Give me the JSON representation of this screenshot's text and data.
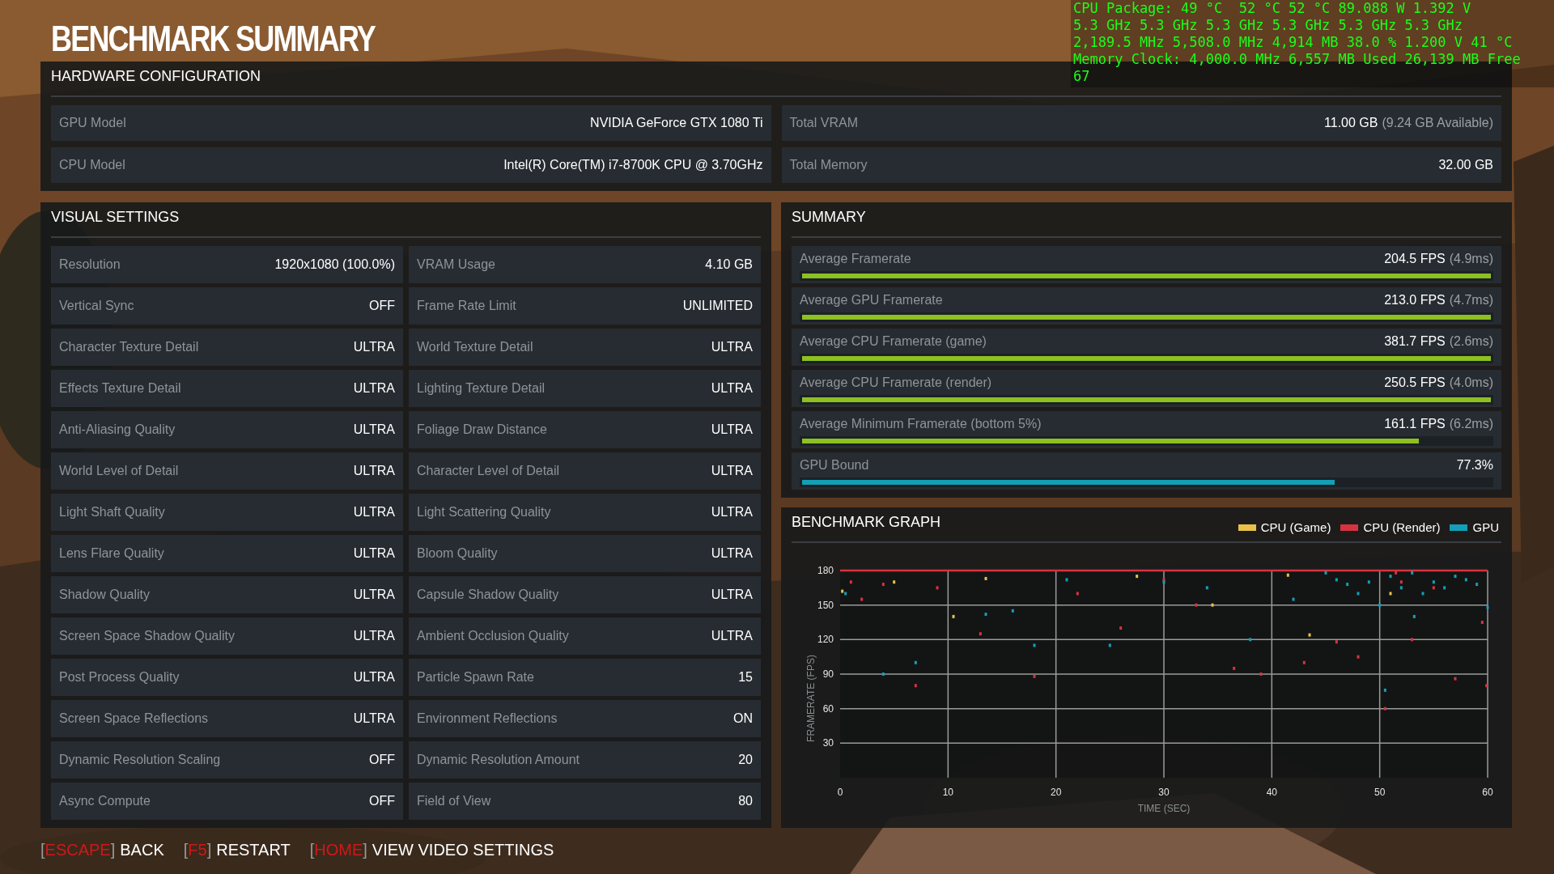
{
  "title": "BENCHMARK SUMMARY",
  "overlay": [
    "CPU Package: 49 °C  52 °C 52 °C 89.088 W 1.392 V",
    "5.3 GHz 5.3 GHz 5.3 GHz 5.3 GHz 5.3 GHz 5.3 GHz",
    "2,189.5 MHz 5,508.0 MHz 4,914 MB 38.0 % 1.200 V 41 °C",
    "Memory Clock: 4,000.0 MHz 6,557 MB Used 26,139 MB Free",
    "67"
  ],
  "hardware": {
    "heading": "HARDWARE CONFIGURATION",
    "items": [
      {
        "label": "GPU Model",
        "value": "NVIDIA GeForce GTX 1080 Ti"
      },
      {
        "label": "Total VRAM",
        "value": "11.00 GB",
        "detail": "(9.24 GB Available)"
      },
      {
        "label": "CPU Model",
        "value": "Intel(R) Core(TM) i7-8700K CPU @ 3.70GHz"
      },
      {
        "label": "Total Memory",
        "value": "32.00 GB"
      }
    ]
  },
  "visual_settings": {
    "heading": "VISUAL SETTINGS",
    "items": [
      {
        "label": "Resolution",
        "value": "1920x1080 (100.0%)"
      },
      {
        "label": "VRAM Usage",
        "value": "4.10 GB"
      },
      {
        "label": "Vertical Sync",
        "value": "OFF"
      },
      {
        "label": "Frame Rate Limit",
        "value": "UNLIMITED"
      },
      {
        "label": "Character Texture Detail",
        "value": "ULTRA"
      },
      {
        "label": "World Texture Detail",
        "value": "ULTRA"
      },
      {
        "label": "Effects Texture Detail",
        "value": "ULTRA"
      },
      {
        "label": "Lighting Texture Detail",
        "value": "ULTRA"
      },
      {
        "label": "Anti-Aliasing Quality",
        "value": "ULTRA"
      },
      {
        "label": "Foliage Draw Distance",
        "value": "ULTRA"
      },
      {
        "label": "World Level of Detail",
        "value": "ULTRA"
      },
      {
        "label": "Character Level of Detail",
        "value": "ULTRA"
      },
      {
        "label": "Light Shaft Quality",
        "value": "ULTRA"
      },
      {
        "label": "Light Scattering Quality",
        "value": "ULTRA"
      },
      {
        "label": "Lens Flare Quality",
        "value": "ULTRA"
      },
      {
        "label": "Bloom Quality",
        "value": "ULTRA"
      },
      {
        "label": "Shadow Quality",
        "value": "ULTRA"
      },
      {
        "label": "Capsule Shadow Quality",
        "value": "ULTRA"
      },
      {
        "label": "Screen Space Shadow Quality",
        "value": "ULTRA"
      },
      {
        "label": "Ambient Occlusion Quality",
        "value": "ULTRA"
      },
      {
        "label": "Post Process Quality",
        "value": "ULTRA"
      },
      {
        "label": "Particle Spawn Rate",
        "value": "15"
      },
      {
        "label": "Screen Space Reflections",
        "value": "ULTRA"
      },
      {
        "label": "Environment Reflections",
        "value": "ON"
      },
      {
        "label": "Dynamic Resolution Scaling",
        "value": "OFF"
      },
      {
        "label": "Dynamic Resolution Amount",
        "value": "20"
      },
      {
        "label": "Async Compute",
        "value": "OFF"
      },
      {
        "label": "Field of View",
        "value": "80"
      }
    ]
  },
  "summary": {
    "heading": "SUMMARY",
    "items": [
      {
        "label": "Average Framerate",
        "value": "204.5 FPS",
        "detail": "(4.9ms)",
        "level": 1.0,
        "color": "#8dc021"
      },
      {
        "label": "Average GPU Framerate",
        "value": "213.0 FPS",
        "detail": "(4.7ms)",
        "level": 1.0,
        "color": "#8dc021"
      },
      {
        "label": "Average CPU Framerate (game)",
        "value": "381.7 FPS",
        "detail": "(2.6ms)",
        "level": 1.0,
        "color": "#8dc021"
      },
      {
        "label": "Average CPU Framerate (render)",
        "value": "250.5 FPS",
        "detail": "(4.0ms)",
        "level": 1.0,
        "color": "#8dc021"
      },
      {
        "label": "Average Minimum Framerate (bottom 5%)",
        "value": "161.1 FPS",
        "detail": "(6.2ms)",
        "level": 0.895,
        "color": "#8dc021"
      },
      {
        "label": "GPU Bound",
        "value": "77.3%",
        "level": 0.773,
        "color": "#139fb6"
      }
    ]
  },
  "graph": {
    "heading": "BENCHMARK GRAPH",
    "chart_data": {
      "type": "scatter",
      "xlabel": "TIME (SEC)",
      "ylabel": "FRAMERATE (FPS)",
      "xlim": [
        0,
        60
      ],
      "ylim": [
        0,
        180
      ],
      "xticks": [
        0,
        10,
        20,
        30,
        40,
        50,
        60
      ],
      "yticks": [
        30,
        60,
        90,
        120,
        150,
        180
      ],
      "grid": true,
      "series": [
        {
          "name": "CPU (Game)",
          "color": "#e8c14a",
          "x": [
            0.2,
            5,
            10.5,
            13.5,
            27.5,
            34.5,
            41.5,
            43.5,
            51
          ],
          "values": [
            162,
            170,
            140,
            173,
            175,
            150,
            176,
            124,
            160
          ]
        },
        {
          "name": "CPU (Render)",
          "color": "#d63340",
          "x": [
            1,
            2,
            4,
            7,
            9,
            13,
            18,
            22,
            26,
            30,
            33,
            36.5,
            39,
            43,
            46,
            48,
            50.5,
            51.5,
            52,
            53,
            55,
            57,
            59.5,
            59.9
          ],
          "values": [
            170,
            155,
            168,
            80,
            165,
            125,
            88,
            160,
            130,
            172,
            150,
            95,
            90,
            100,
            118,
            105,
            60,
            178,
            170,
            120,
            165,
            86,
            135,
            80
          ]
        },
        {
          "name": "GPU",
          "color": "#139fb6",
          "x": [
            0.5,
            4,
            7,
            13.5,
            16,
            18,
            21,
            25,
            30,
            34,
            38,
            42,
            45,
            46,
            47,
            48,
            49,
            50,
            50.5,
            51,
            52,
            53,
            53.2,
            54,
            55,
            56,
            57,
            58,
            59,
            60
          ],
          "values": [
            160,
            90,
            100,
            142,
            145,
            115,
            172,
            115,
            170,
            165,
            120,
            155,
            178,
            172,
            168,
            160,
            170,
            150,
            76,
            175,
            165,
            178,
            140,
            160,
            170,
            165,
            175,
            172,
            168,
            148
          ]
        }
      ]
    }
  },
  "footer": [
    {
      "open": "[",
      "key": "ESCAPE",
      "close": "]",
      "action": "BACK"
    },
    {
      "open": "[",
      "key": "F5",
      "close": "]",
      "action": "RESTART"
    },
    {
      "open": "[",
      "key": "HOME",
      "close": "]",
      "action": "VIEW VIDEO SETTINGS"
    }
  ]
}
